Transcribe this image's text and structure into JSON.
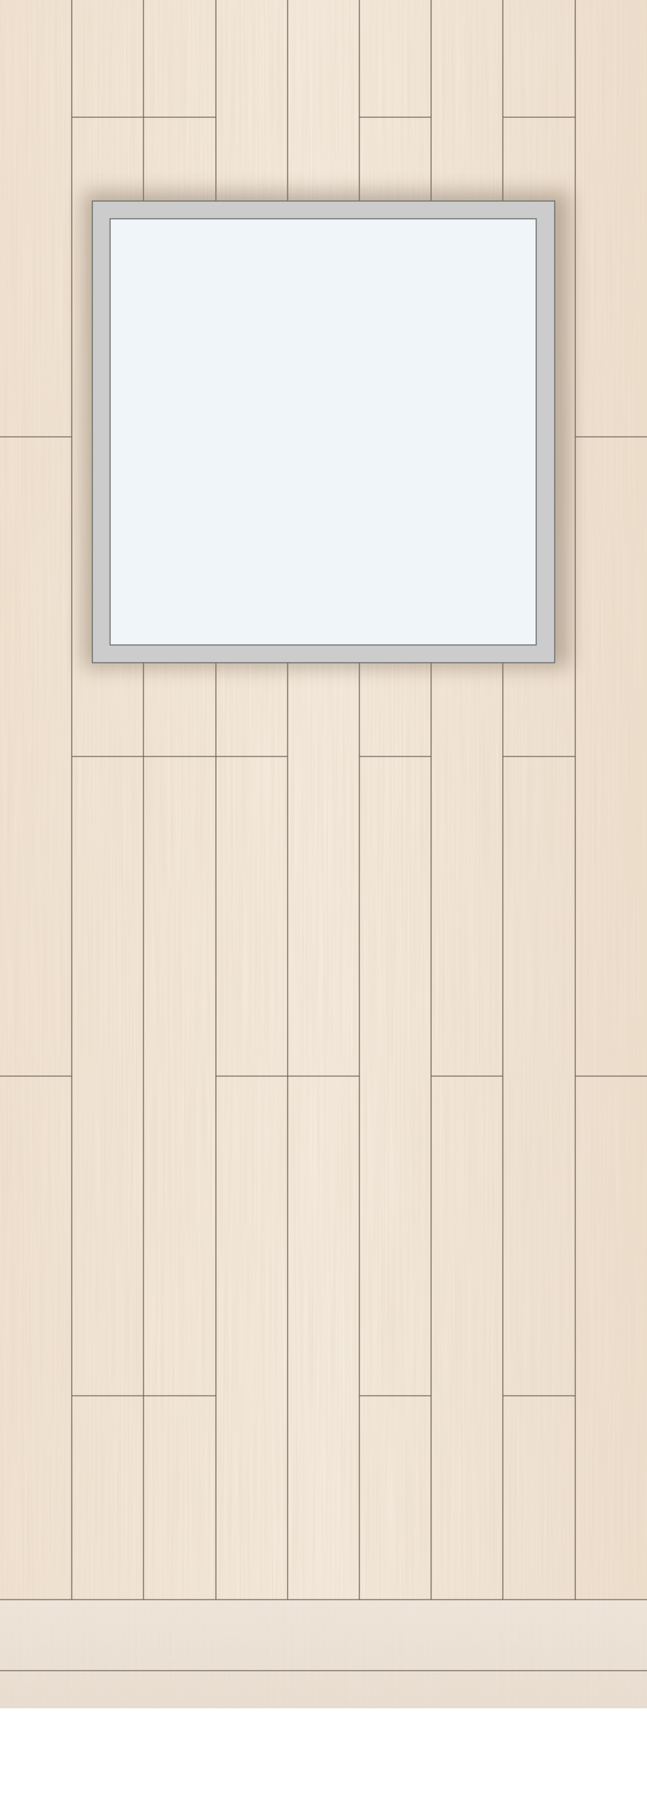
{
  "door": {
    "style": "vertical wooden plank door with square glass panel",
    "colors": {
      "wood_light": "#f3e8db",
      "wood_mid": "#ead8c4",
      "wood_dark": "#d9c2a6",
      "joint_line": "#6e6259",
      "frame_silver": "#cccccc",
      "frame_edge": "#6f6f6f",
      "glass": "#eff5f9",
      "kickplate": "#ede4da",
      "background": "#ffffff"
    },
    "plank_count": 9,
    "glass_panel_shape": "square",
    "glass_panel_icon": "frosted-glass-window-icon"
  }
}
